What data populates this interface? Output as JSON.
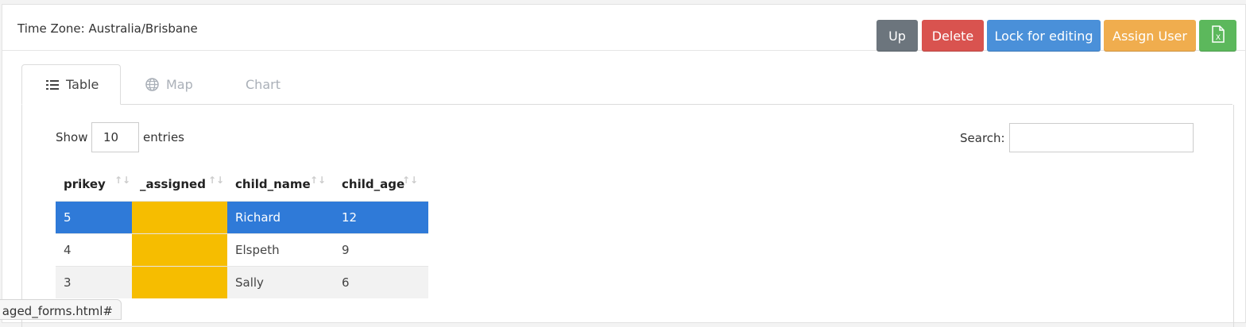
{
  "header": {
    "timezone": "Time Zone: Australia/Brisbane"
  },
  "toolbar": {
    "up": "Up",
    "delete": "Delete",
    "lock": "Lock for editing",
    "assign": "Assign User",
    "excel_icon": "excel-icon"
  },
  "tabs": [
    {
      "label": "Table",
      "icon": "list-icon",
      "active": true
    },
    {
      "label": "Map",
      "icon": "globe-icon",
      "active": false
    },
    {
      "label": "Chart",
      "active": false
    }
  ],
  "controls": {
    "show_label": "Show",
    "page_size": "10",
    "entries_label": "entries",
    "search_label": "Search:",
    "search_value": ""
  },
  "table": {
    "columns": [
      "prikey",
      "_assigned",
      "child_name",
      "child_age"
    ],
    "rows": [
      {
        "prikey": "5",
        "assigned": "",
        "child_name": "Richard",
        "child_age": "12",
        "selected": true
      },
      {
        "prikey": "4",
        "assigned": "",
        "child_name": "Elspeth",
        "child_age": "9",
        "selected": false
      },
      {
        "prikey": "3",
        "assigned": "",
        "child_name": "Sally",
        "child_age": "6",
        "selected": false
      }
    ],
    "assigned_color": "#f6bd00",
    "selected_color": "#2f7ad8"
  },
  "status_url": "aged_forms.html#"
}
